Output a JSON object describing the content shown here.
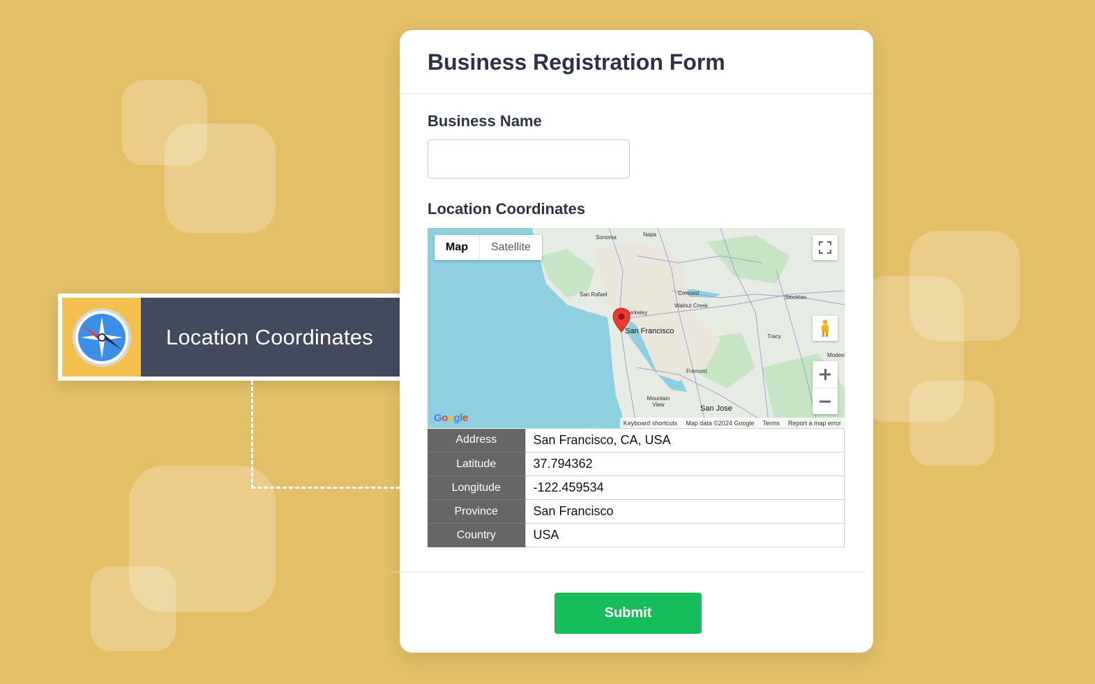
{
  "badge": {
    "label": "Location Coordinates",
    "icon": "compass-icon"
  },
  "form": {
    "title": "Business Registration Form",
    "business_name": {
      "label": "Business Name",
      "value": "",
      "placeholder": ""
    },
    "location": {
      "label": "Location Coordinates",
      "map": {
        "tabs": [
          {
            "label": "Map",
            "active": true
          },
          {
            "label": "Satellite",
            "active": false
          }
        ],
        "places": [
          "Sonoma",
          "Napa",
          "San Rafael",
          "Berkeley",
          "Concord",
          "Walnut Creek",
          "Stockton",
          "San Francisco",
          "Tracy",
          "Fremont",
          "Mountain View",
          "San Jose",
          "Modesto"
        ],
        "logo": "Google",
        "attribution": [
          "Keyboard shortcuts",
          "Map data ©2024 Google",
          "Terms",
          "Report a map error"
        ]
      },
      "fields": [
        {
          "label": "Address",
          "value": "San Francisco, CA, USA"
        },
        {
          "label": "Latitude",
          "value": "37.794362"
        },
        {
          "label": "Longitude",
          "value": "-122.459534"
        },
        {
          "label": "Province",
          "value": "San Francisco"
        },
        {
          "label": "Country",
          "value": "USA"
        }
      ]
    },
    "submit_label": "Submit"
  },
  "colors": {
    "background": "#e3bf68",
    "submit": "#18bd5b",
    "badge_dark": "#434a5e",
    "badge_accent": "#f4c04d",
    "title": "#2c3345"
  }
}
